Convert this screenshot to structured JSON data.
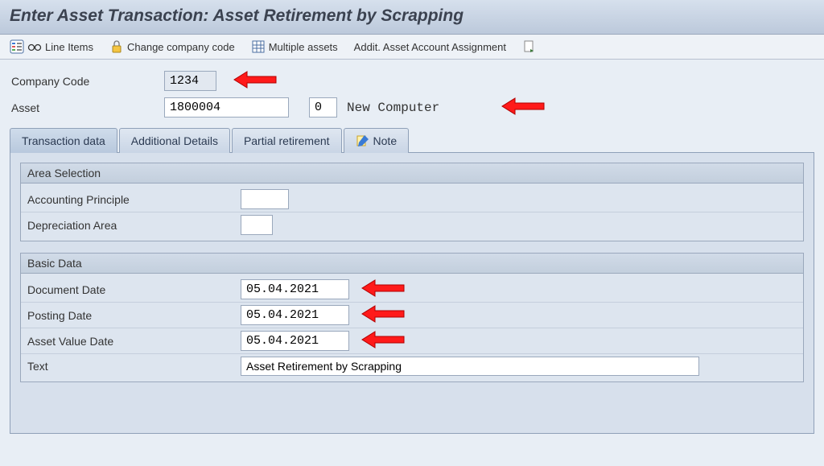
{
  "title": "Enter Asset Transaction: Asset Retirement by Scrapping",
  "toolbar": {
    "line_items": "Line Items",
    "change_company": "Change company code",
    "multiple_assets": "Multiple assets",
    "addit_assign": "Addit. Asset Account Assignment"
  },
  "header": {
    "company_code_label": "Company Code",
    "company_code_value": "1234",
    "asset_label": "Asset",
    "asset_value": "1800004",
    "asset_sub_value": "0",
    "asset_desc": "New Computer"
  },
  "tabs": {
    "transaction": "Transaction data",
    "additional": "Additional Details",
    "partial": "Partial retirement",
    "note": "Note"
  },
  "area_selection": {
    "group_title": "Area Selection",
    "accounting_principle_label": "Accounting Principle",
    "accounting_principle_value": "",
    "depreciation_area_label": "Depreciation Area",
    "depreciation_area_value": ""
  },
  "basic_data": {
    "group_title": "Basic Data",
    "document_date_label": "Document Date",
    "document_date_value": "05.04.2021",
    "posting_date_label": "Posting Date",
    "posting_date_value": "05.04.2021",
    "asset_value_date_label": "Asset Value Date",
    "asset_value_date_value": "05.04.2021",
    "text_label": "Text",
    "text_value": "Asset Retirement by Scrapping"
  }
}
